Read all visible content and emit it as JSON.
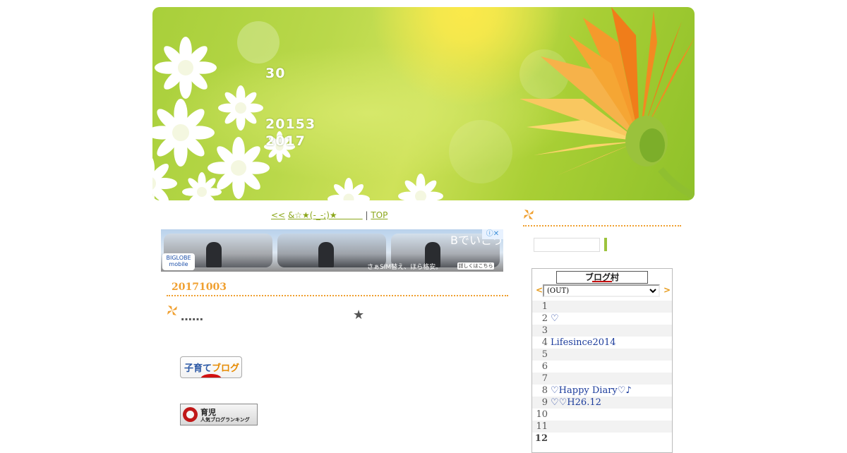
{
  "header": {
    "title_line1": "30",
    "title_line2": "20153",
    "title_line3": "2017"
  },
  "nav": {
    "prev": "<<",
    "entry": "&☆★(-_-;)★　　　",
    "separator": "|",
    "top": "TOP"
  },
  "ad": {
    "brand": "BIGLOBE mobile",
    "headline": "Bでいこう",
    "tagline": "さぁSIM替え、ほら格安。",
    "detail_button": "詳しくはこちら",
    "info_icon": "ⓘ✕"
  },
  "post": {
    "date": "20171003",
    "title": "……",
    "star": "★",
    "banner_kosodate": {
      "part1": "子育て",
      "part2": "ブログ"
    },
    "banner_ikuji": {
      "line1": "育児",
      "line2": "人気ブログランキング"
    }
  },
  "sidebar": {
    "search_placeholder": "",
    "widget": {
      "logo": "ブログ村",
      "prev_arrow": "<",
      "next_arrow": ">",
      "selected": "(OUT)",
      "ranking": [
        {
          "num": "1",
          "label": ""
        },
        {
          "num": "2",
          "label": "♡"
        },
        {
          "num": "3",
          "label": ""
        },
        {
          "num": "4",
          "label": "Lifesince2014"
        },
        {
          "num": "5",
          "label": ""
        },
        {
          "num": "6",
          "label": ""
        },
        {
          "num": "7",
          "label": ""
        },
        {
          "num": "8",
          "label": "♡Happy Diary♡♪"
        },
        {
          "num": "9",
          "label": "♡♡H26.12"
        },
        {
          "num": "10",
          "label": ""
        },
        {
          "num": "11",
          "label": ""
        },
        {
          "num": "12",
          "label": ""
        }
      ]
    }
  },
  "colors": {
    "accent_orange": "#f0a030",
    "link_green": "#8ba61a",
    "rank_link": "#1c3c9c"
  }
}
